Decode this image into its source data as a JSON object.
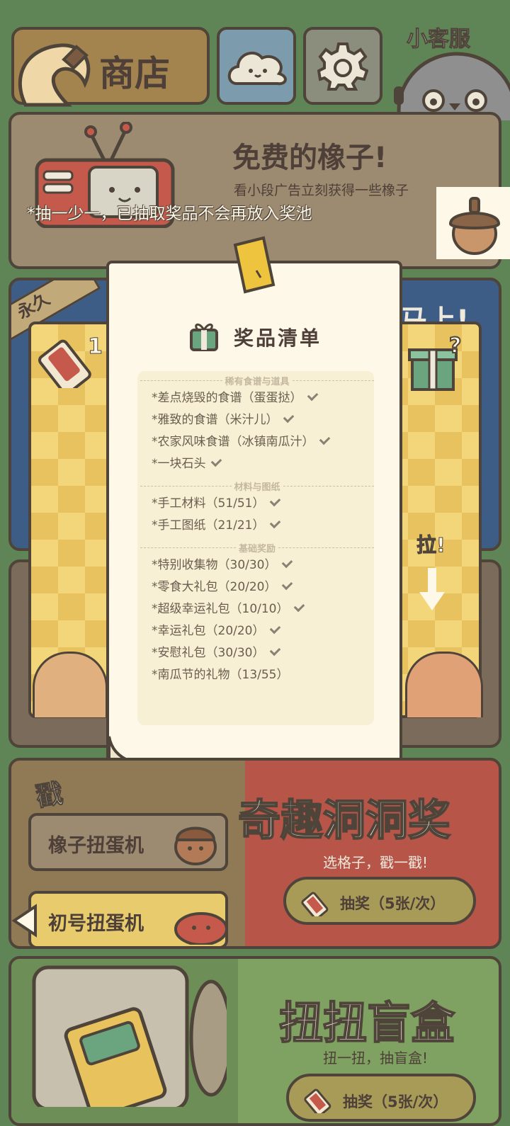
{
  "header": {
    "shop_title": "商店",
    "customer_service": "小客服"
  },
  "free_acorns": {
    "title": "免费的橡子!",
    "subtitle": "看小段广告立刻获得一些橡子",
    "notice": "*抽一少一，已抽取奖品不会再放入奖池"
  },
  "machine": {
    "ribbon": "永久",
    "ticket_count": "1",
    "pull_label": "拉!",
    "ticker_right": "马上!"
  },
  "prize_list": {
    "title": "奖品清单",
    "sections": [
      {
        "header": "稀有食谱与道具",
        "items": [
          {
            "label": "*差点烧毁的食谱（蛋蛋挞）",
            "done": true
          },
          {
            "label": "*雅致的食谱（米汁儿）",
            "done": true
          },
          {
            "label": "*农家风味食谱（冰镇南瓜汁）",
            "done": true
          },
          {
            "label": "*一块石头",
            "done": true
          }
        ]
      },
      {
        "header": "材料与图纸",
        "items": [
          {
            "label": "*手工材料（51/51）",
            "done": true
          },
          {
            "label": "*手工图纸（21/21）",
            "done": true
          }
        ]
      },
      {
        "header": "基础奖励",
        "items": [
          {
            "label": "*特别收集物（30/30）",
            "done": true
          },
          {
            "label": "*零食大礼包（20/20）",
            "done": true
          },
          {
            "label": "*超级幸运礼包（10/10）",
            "done": true
          },
          {
            "label": "*幸运礼包（20/20）",
            "done": true
          },
          {
            "label": "*安慰礼包（30/30）",
            "done": true
          },
          {
            "label": "*南瓜节的礼物（13/55）",
            "done": false
          }
        ]
      }
    ]
  },
  "hole_prize": {
    "poke": "戳",
    "title": "奇趣洞洞奖",
    "subtitle": "选格子，戳一戳!",
    "draw_button": "抽奖（5张/次）"
  },
  "side_tabs": {
    "acorn_gacha": "橡子扭蛋机",
    "first_gacha": "初号扭蛋机"
  },
  "blind_box": {
    "title": "扭扭盲盒",
    "subtitle": "扭一扭，抽盲盒!",
    "draw_button": "抽奖（5张/次）"
  },
  "colors": {
    "outline": "#4f4439",
    "paper": "#fdf8e8",
    "banner": "#9c8a71",
    "hole_bg": "#b65548",
    "blind_bg": "#7fa161"
  }
}
